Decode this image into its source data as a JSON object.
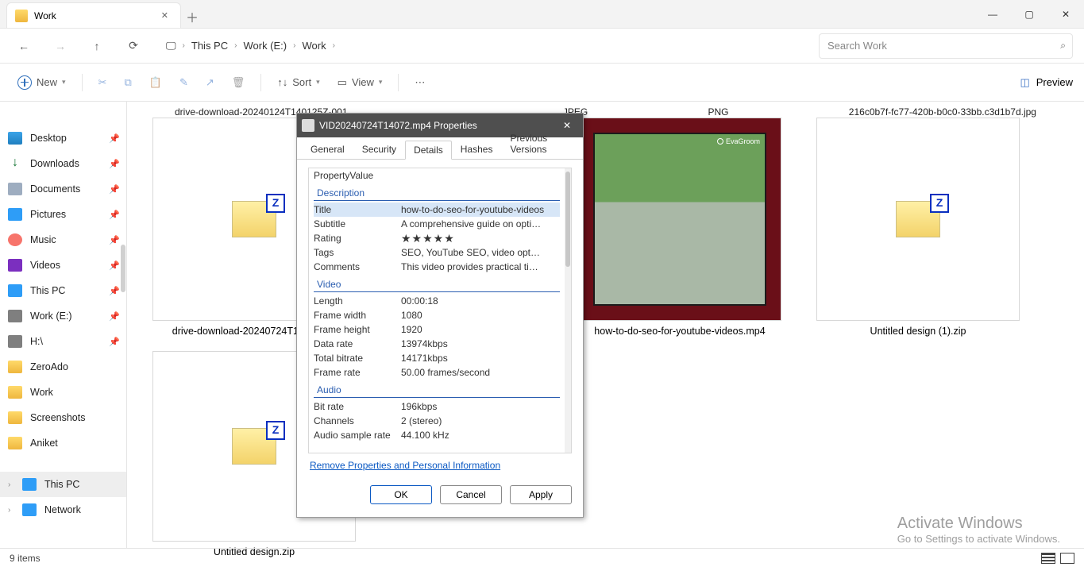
{
  "tab": {
    "title": "Work"
  },
  "breadcrumb": {
    "pc": "This PC",
    "drive": "Work (E:)",
    "folder": "Work"
  },
  "search": {
    "placeholder": "Search Work"
  },
  "toolbar": {
    "new": "New",
    "sort": "Sort",
    "view": "View",
    "preview": "Preview"
  },
  "sidebar": {
    "quick": [
      {
        "label": "Desktop",
        "icon": "desktop",
        "pinned": true
      },
      {
        "label": "Downloads",
        "icon": "downloads",
        "pinned": true,
        "glyph": "↓"
      },
      {
        "label": "Documents",
        "icon": "docs",
        "pinned": true
      },
      {
        "label": "Pictures",
        "icon": "pics",
        "pinned": true
      },
      {
        "label": "Music",
        "icon": "music",
        "pinned": true
      },
      {
        "label": "Videos",
        "icon": "videos",
        "pinned": true
      },
      {
        "label": "This PC",
        "icon": "pc",
        "pinned": true
      },
      {
        "label": "Work (E:)",
        "icon": "drive",
        "pinned": true
      },
      {
        "label": "H:\\",
        "icon": "drive",
        "pinned": true
      },
      {
        "label": "ZeroAdo",
        "icon": "folder"
      },
      {
        "label": "Work",
        "icon": "folder"
      },
      {
        "label": "Screenshots",
        "icon": "folder"
      },
      {
        "label": "Aniket",
        "icon": "folder"
      }
    ],
    "tree": [
      {
        "label": "This PC",
        "icon": "pc",
        "selected": true
      },
      {
        "label": "Network",
        "icon": "net"
      }
    ]
  },
  "files": {
    "plabels": {
      "p0": "drive-download-20240124T140125Z-001",
      "p1": "JPEG",
      "p2": "PNG",
      "p3": "216c0b7f-fc77-420b-b0c0-33bb.c3d1b7d.jpg"
    },
    "grid": [
      {
        "label": "drive-download-20240724T140729…",
        "kind": "zip"
      },
      {
        "label": "how-to-do-seo-for-youtube-videos.mp4",
        "kind": "video",
        "brand": "EvaGroom"
      },
      {
        "label": "Untitled design (1).zip",
        "kind": "zip"
      },
      {
        "label": "Untitled design.zip",
        "kind": "zip"
      }
    ]
  },
  "status": {
    "text": "9 items"
  },
  "watermark": {
    "line1": "Activate Windows",
    "line2": "Go to Settings to activate Windows."
  },
  "dialog": {
    "title": "VID20240724T14072.mp4 Properties",
    "tabs": {
      "general": "General",
      "security": "Security",
      "details": "Details",
      "hashes": "Hashes",
      "prev": "Previous Versions"
    },
    "header": {
      "property": "Property",
      "value": "Value"
    },
    "sections": {
      "desc": "Description",
      "video": "Video",
      "audio": "Audio"
    },
    "rows": {
      "title": {
        "k": "Title",
        "v": "how-to-do-seo-for-youtube-videos"
      },
      "subtitle": {
        "k": "Subtitle",
        "v": "A comprehensive guide on opti…"
      },
      "rating": {
        "k": "Rating",
        "v": "★★★★★"
      },
      "tags": {
        "k": "Tags",
        "v": "SEO, YouTube SEO, video opt…"
      },
      "comments": {
        "k": "Comments",
        "v": "This video provides practical ti…"
      },
      "length": {
        "k": "Length",
        "v": "00:00:18"
      },
      "fwidth": {
        "k": "Frame width",
        "v": "1080"
      },
      "fheight": {
        "k": "Frame height",
        "v": "1920"
      },
      "drate": {
        "k": "Data rate",
        "v": "13974kbps"
      },
      "tbitrate": {
        "k": "Total bitrate",
        "v": "14171kbps"
      },
      "frate": {
        "k": "Frame rate",
        "v": "50.00 frames/second"
      },
      "bitrate": {
        "k": "Bit rate",
        "v": "196kbps"
      },
      "channels": {
        "k": "Channels",
        "v": "2 (stereo)"
      },
      "asample": {
        "k": "Audio sample rate",
        "v": "44.100 kHz"
      }
    },
    "remove_link": "Remove Properties and Personal Information",
    "buttons": {
      "ok": "OK",
      "cancel": "Cancel",
      "apply": "Apply"
    }
  }
}
